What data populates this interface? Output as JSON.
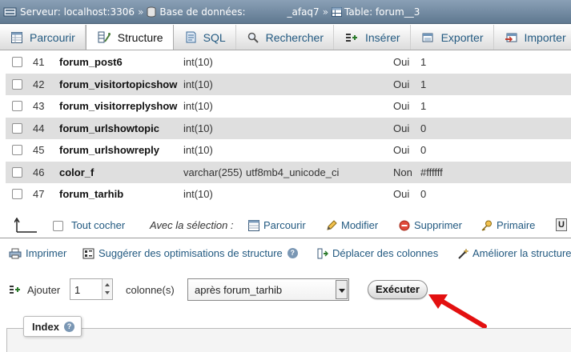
{
  "breadcrumb": {
    "server_label": "Serveur: localhost:3306",
    "database_label": "Base de données:",
    "database_name": "_afaq7",
    "table_label": "Table: forum__3",
    "separator": "»"
  },
  "tabs": [
    {
      "label": "Parcourir",
      "icon": "browse-icon",
      "active": false
    },
    {
      "label": "Structure",
      "icon": "structure-icon",
      "active": true
    },
    {
      "label": "SQL",
      "icon": "sql-icon",
      "active": false
    },
    {
      "label": "Rechercher",
      "icon": "search-icon",
      "active": false
    },
    {
      "label": "Insérer",
      "icon": "insert-icon",
      "active": false
    },
    {
      "label": "Exporter",
      "icon": "export-icon",
      "active": false
    },
    {
      "label": "Importer",
      "icon": "import-icon",
      "active": false
    }
  ],
  "rows": [
    {
      "num": "41",
      "name": "forum_post6",
      "type": "int(10)",
      "collation": "",
      "null": "Oui",
      "default": "1"
    },
    {
      "num": "42",
      "name": "forum_visitortopicshow",
      "type": "int(10)",
      "collation": "",
      "null": "Oui",
      "default": "1"
    },
    {
      "num": "43",
      "name": "forum_visitorreplyshow",
      "type": "int(10)",
      "collation": "",
      "null": "Oui",
      "default": "1"
    },
    {
      "num": "44",
      "name": "forum_urlshowtopic",
      "type": "int(10)",
      "collation": "",
      "null": "Oui",
      "default": "0"
    },
    {
      "num": "45",
      "name": "forum_urlshowreply",
      "type": "int(10)",
      "collation": "",
      "null": "Oui",
      "default": "0"
    },
    {
      "num": "46",
      "name": "color_f",
      "type": "varchar(255)",
      "collation": "utf8mb4_unicode_ci",
      "null": "Non",
      "default": "#ffffff"
    },
    {
      "num": "47",
      "name": "forum_tarhib",
      "type": "int(10)",
      "collation": "",
      "null": "Oui",
      "default": "0"
    }
  ],
  "selection": {
    "check_all": "Tout cocher",
    "with_selection": "Avec la sélection :",
    "browse": "Parcourir",
    "modify": "Modifier",
    "delete": "Supprimer",
    "primary": "Primaire",
    "unique_cut": "U"
  },
  "actions": {
    "print": "Imprimer",
    "suggest": "Suggérer des optimisations de structure",
    "move_columns": "Déplacer des colonnes",
    "improve": "Améliorer la structure"
  },
  "add_columns": {
    "add_label": "Ajouter",
    "count": "1",
    "columns_label": "colonne(s)",
    "position_value": "après forum_tarhib",
    "submit": "Exécuter"
  },
  "index": {
    "legend": "Index"
  },
  "colors": {
    "link": "#235a81",
    "row_alt": "#dfdfdf",
    "annotation_arrow": "#e31010"
  }
}
